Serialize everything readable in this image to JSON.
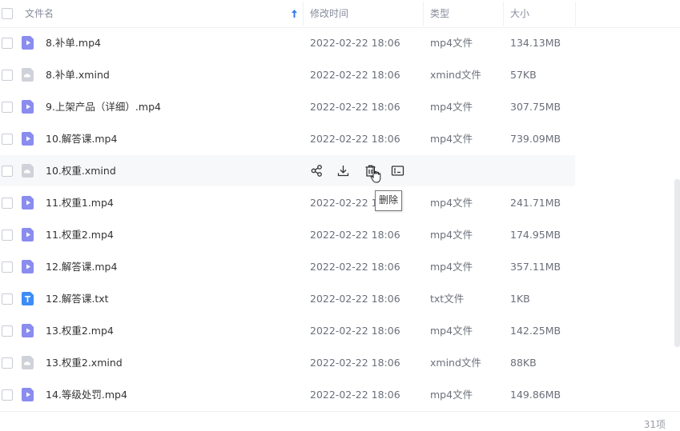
{
  "table": {
    "columns": {
      "name": "文件名",
      "modified": "修改时间",
      "type": "类型",
      "size": "大小"
    },
    "sort": {
      "column": "name",
      "direction": "ascending"
    },
    "rows": [
      {
        "name": "8.补单.mp4",
        "modified": "2022-02-22 18:06",
        "type": "mp4文件",
        "size": "134.13MB",
        "icon": "video-file-icon"
      },
      {
        "name": "8.补单.xmind",
        "modified": "2022-02-22 18:06",
        "type": "xmind文件",
        "size": "57KB",
        "icon": "cloud-file-icon"
      },
      {
        "name": "9.上架产品（详细）.mp4",
        "modified": "2022-02-22 18:06",
        "type": "mp4文件",
        "size": "307.75MB",
        "icon": "video-file-icon"
      },
      {
        "name": "10.解答课.mp4",
        "modified": "2022-02-22 18:06",
        "type": "mp4文件",
        "size": "739.09MB",
        "icon": "video-file-icon"
      },
      {
        "name": "10.权重.xmind",
        "modified": "",
        "type": "",
        "size": "",
        "icon": "cloud-file-icon"
      },
      {
        "name": "11.权重1.mp4",
        "modified": "2022-02-22 18:06",
        "type": "mp4文件",
        "size": "241.71MB",
        "icon": "video-file-icon"
      },
      {
        "name": "11.权重2.mp4",
        "modified": "2022-02-22 18:06",
        "type": "mp4文件",
        "size": "174.95MB",
        "icon": "video-file-icon"
      },
      {
        "name": "12.解答课.mp4",
        "modified": "2022-02-22 18:06",
        "type": "mp4文件",
        "size": "357.11MB",
        "icon": "video-file-icon"
      },
      {
        "name": "12.解答课.txt",
        "modified": "2022-02-22 18:06",
        "type": "txt文件",
        "size": "1KB",
        "icon": "text-file-icon"
      },
      {
        "name": "13.权重2.mp4",
        "modified": "2022-02-22 18:06",
        "type": "mp4文件",
        "size": "142.25MB",
        "icon": "video-file-icon"
      },
      {
        "name": "13.权重2.xmind",
        "modified": "2022-02-22 18:06",
        "type": "xmind文件",
        "size": "88KB",
        "icon": "cloud-file-icon"
      },
      {
        "name": "14.等级处罚.mp4",
        "modified": "2022-02-22 18:06",
        "type": "mp4文件",
        "size": "149.86MB",
        "icon": "video-file-icon"
      }
    ],
    "hover_row_index": 4,
    "hover_actions": [
      "share-icon",
      "download-icon",
      "delete-icon",
      "rename-icon"
    ]
  },
  "tooltip": {
    "text": "删除"
  },
  "footer": {
    "count": "31项"
  },
  "colors": {
    "accent": "#2f80ed",
    "video_icon": "#8a8cf0",
    "cloud_icon": "#c9ccd3",
    "text_icon": "#3d8df5",
    "hover_row": "#f7f8fa"
  }
}
